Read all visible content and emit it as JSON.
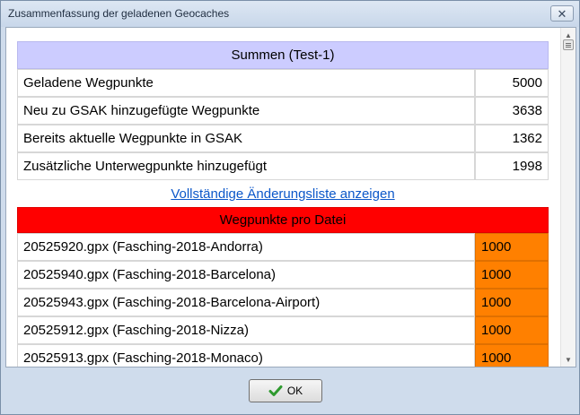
{
  "window": {
    "title": "Zusammenfassung der geladenen Geocaches",
    "close_glyph": "✕"
  },
  "summary": {
    "header": "Summen (Test-1)",
    "rows": [
      {
        "label": "Geladene Wegpunkte",
        "value": "5000"
      },
      {
        "label": "Neu zu GSAK hinzugefügte Wegpunkte",
        "value": "3638"
      },
      {
        "label": "Bereits aktuelle Wegpunkte in GSAK",
        "value": "1362"
      },
      {
        "label": "Zusätzliche Unterwegpunkte hinzugefügt",
        "value": "1998"
      }
    ],
    "link_text": "Vollständige Änderungsliste anzeigen"
  },
  "per_file": {
    "header": "Wegpunkte pro Datei",
    "rows": [
      {
        "label": "20525920.gpx (Fasching-2018-Andorra)",
        "value": "1000"
      },
      {
        "label": "20525940.gpx (Fasching-2018-Barcelona)",
        "value": "1000"
      },
      {
        "label": "20525943.gpx (Fasching-2018-Barcelona-Airport)",
        "value": "1000"
      },
      {
        "label": "20525912.gpx (Fasching-2018-Nizza)",
        "value": "1000"
      },
      {
        "label": "20525913.gpx (Fasching-2018-Monaco)",
        "value": "1000"
      }
    ]
  },
  "footer": {
    "ok_label": "OK"
  },
  "colors": {
    "summary_header": "#ccccff",
    "per_file_header": "#ff0000",
    "value_highlight": "#ff8000",
    "link": "#0b57c9"
  },
  "icons": {
    "ok": "check-icon",
    "close": "close-icon",
    "scroll_thumb": "scroll-thumb-grip-icon"
  }
}
